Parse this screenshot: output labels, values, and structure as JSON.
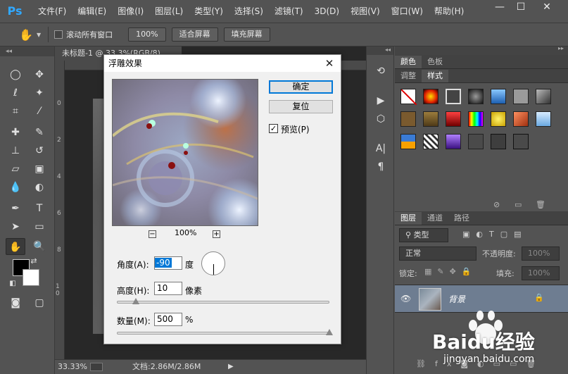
{
  "menubar": {
    "logo": "Ps",
    "items": [
      "文件(F)",
      "编辑(E)",
      "图像(I)",
      "图层(L)",
      "类型(Y)",
      "选择(S)",
      "滤镜(T)",
      "3D(D)",
      "视图(V)",
      "窗口(W)",
      "帮助(H)"
    ],
    "minimize": "—",
    "maximize": "☐",
    "close": "✕"
  },
  "options": {
    "scroll_all_label": "滚动所有窗口",
    "zoom_100": "100%",
    "fit_screen": "适合屏幕",
    "fill_screen": "填充屏幕"
  },
  "document": {
    "tab_title": "未标题-1 @ 33.3%(RGB/8)",
    "ruler_v": [
      "0",
      "2",
      "4",
      "6",
      "8",
      "1 0"
    ],
    "zoom": "33.33%",
    "doc_info": "文档:2.86M/2.86M"
  },
  "panels": {
    "color_tabs": [
      "颜色",
      "色板"
    ],
    "style_tabs": [
      "调整",
      "样式"
    ],
    "layers_tabs": [
      "图层",
      "通道",
      "路径"
    ],
    "filter_kind": "类型",
    "blend_mode": "正常",
    "opacity_label": "不透明度:",
    "opacity_value": "100%",
    "lock_label": "锁定:",
    "fill_label": "填充:",
    "fill_value": "100%",
    "layer_name": "背景"
  },
  "dialog": {
    "title": "浮雕效果",
    "ok": "确定",
    "reset": "复位",
    "preview_label": "预览(P)",
    "preview_checked": true,
    "zoom_value": "100%",
    "zoom_minus": "−",
    "zoom_plus": "+",
    "angle_label": "角度(A):",
    "angle_value": "-90",
    "angle_unit": "度",
    "height_label": "高度(H):",
    "height_value": "10",
    "height_unit": "像素",
    "amount_label": "数量(M):",
    "amount_value": "500",
    "amount_unit": "%",
    "height_slider_fraction": 0.09,
    "amount_slider_fraction": 1.0
  },
  "watermark": {
    "brand": "Baidu经验",
    "url": "jingyan.baidu.com"
  },
  "colors": {
    "accent": "#0078d7",
    "ps_blue": "#31a8ff",
    "layer_selected": "#6e7d91"
  }
}
